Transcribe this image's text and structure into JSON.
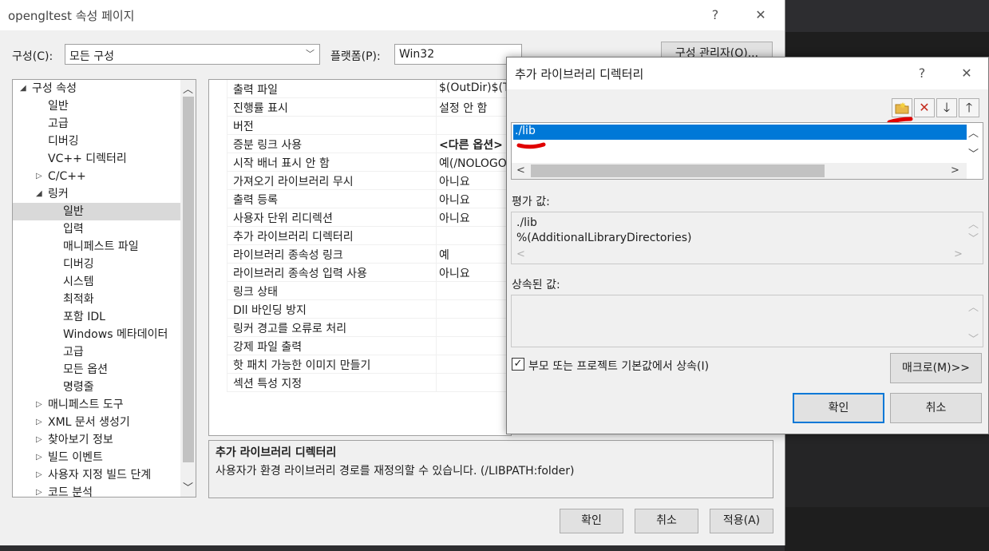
{
  "window": {
    "title": "opengltest 속성 페이지",
    "help": "?",
    "close": "✕"
  },
  "config": {
    "label": "구성(C):",
    "value": "모든 구성"
  },
  "platform": {
    "label": "플랫폼(P):",
    "value": "Win32"
  },
  "config_manager_button": "구성 관리자(O)...",
  "tree": [
    {
      "label": "구성 속성",
      "level": 0,
      "expander": "◢"
    },
    {
      "label": "일반",
      "level": 1
    },
    {
      "label": "고급",
      "level": 1
    },
    {
      "label": "디버깅",
      "level": 1
    },
    {
      "label": "VC++ 디렉터리",
      "level": 1
    },
    {
      "label": "C/C++",
      "level": 1,
      "expander": "▷"
    },
    {
      "label": "링커",
      "level": 1,
      "expander": "◢"
    },
    {
      "label": "일반",
      "level": 2,
      "selected": true
    },
    {
      "label": "입력",
      "level": 2
    },
    {
      "label": "매니페스트 파일",
      "level": 2
    },
    {
      "label": "디버깅",
      "level": 2
    },
    {
      "label": "시스템",
      "level": 2
    },
    {
      "label": "최적화",
      "level": 2
    },
    {
      "label": "포함 IDL",
      "level": 2
    },
    {
      "label": "Windows 메타데이터",
      "level": 2
    },
    {
      "label": "고급",
      "level": 2
    },
    {
      "label": "모든 옵션",
      "level": 2
    },
    {
      "label": "명령줄",
      "level": 2
    },
    {
      "label": "매니페스트 도구",
      "level": 1,
      "expander": "▷"
    },
    {
      "label": "XML 문서 생성기",
      "level": 1,
      "expander": "▷"
    },
    {
      "label": "찾아보기 정보",
      "level": 1,
      "expander": "▷"
    },
    {
      "label": "빌드 이벤트",
      "level": 1,
      "expander": "▷"
    },
    {
      "label": "사용자 지정 빌드 단계",
      "level": 1,
      "expander": "▷"
    },
    {
      "label": "코드 분석",
      "level": 1,
      "expander": "▷"
    }
  ],
  "properties": [
    {
      "name": "출력 파일",
      "value": "$(OutDir)$(T"
    },
    {
      "name": "진행률 표시",
      "value": "설정 안 함"
    },
    {
      "name": "버전",
      "value": ""
    },
    {
      "name": "증분 링크 사용",
      "value": "<다른 옵션>",
      "bold": true
    },
    {
      "name": "시작 배너 표시 안 함",
      "value": "예(/NOLOGO"
    },
    {
      "name": "가져오기 라이브러리 무시",
      "value": "아니요"
    },
    {
      "name": "출력 등록",
      "value": "아니요"
    },
    {
      "name": "사용자 단위 리디렉션",
      "value": "아니요"
    },
    {
      "name": "추가 라이브러리 디렉터리",
      "value": ""
    },
    {
      "name": "라이브러리 종속성 링크",
      "value": "예"
    },
    {
      "name": "라이브러리 종속성 입력 사용",
      "value": "아니요"
    },
    {
      "name": "링크 상태",
      "value": ""
    },
    {
      "name": "Dll 바인딩 방지",
      "value": ""
    },
    {
      "name": "링커 경고를 오류로 처리",
      "value": ""
    },
    {
      "name": "강제 파일 출력",
      "value": ""
    },
    {
      "name": "핫 패치 가능한 이미지 만들기",
      "value": ""
    },
    {
      "name": "섹션 특성 지정",
      "value": ""
    }
  ],
  "description": {
    "title": "추가 라이브러리 디렉터리",
    "text": "사용자가 환경 라이브러리 경로를 재정의할 수 있습니다. (/LIBPATH:folder)"
  },
  "footer": {
    "ok": "확인",
    "cancel": "취소",
    "apply": "적용(A)"
  },
  "dialog": {
    "title": "추가 라이브러리 디렉터리",
    "help": "?",
    "close": "✕",
    "toolbar": {
      "new_folder": "📁",
      "delete": "✕",
      "down": "🡓",
      "up": "🡑"
    },
    "list_items": [
      "./lib"
    ],
    "evaluated_label": "평가 값:",
    "evaluated_lines": [
      "./lib",
      "%(AdditionalLibraryDirectories)"
    ],
    "inherited_label": "상속된 값:",
    "inherit_checkbox": {
      "label": "부모 또는 프로젝트 기본값에서 상속(I)",
      "checked": true,
      "mark": "✓"
    },
    "macros_button": "매크로(M)>>",
    "ok": "확인",
    "cancel": "취소"
  },
  "colors": {
    "selection": "#0078d7",
    "annotation": "#e00000",
    "delete_icon": "#c42b1c"
  }
}
